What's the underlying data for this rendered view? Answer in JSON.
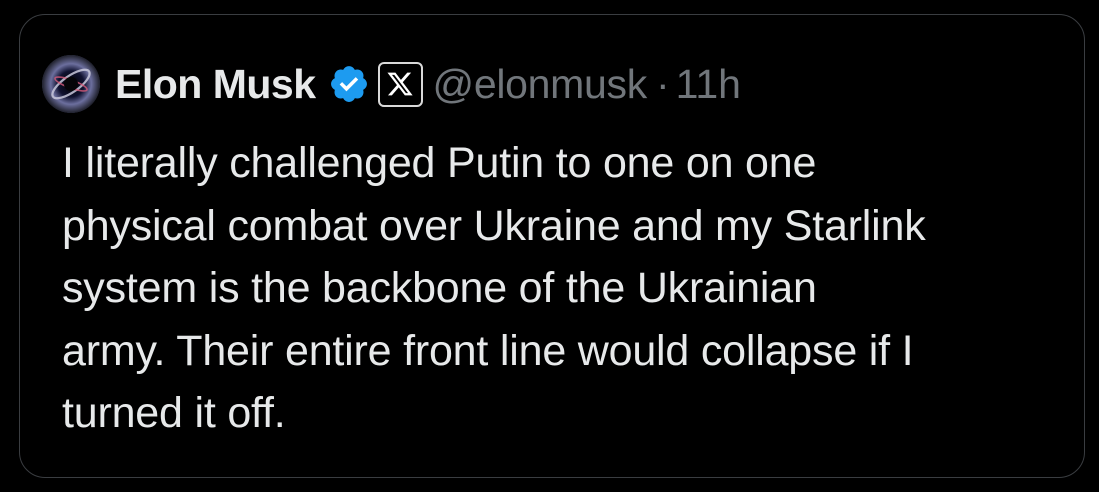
{
  "tweet": {
    "author": {
      "display_name": "Elon Musk",
      "handle": "@elonmusk",
      "verified_icon": "verified-badge-icon",
      "affiliation_icon": "x-logo-icon",
      "avatar_icon": "avatar"
    },
    "separator": "·",
    "timestamp": "11h",
    "text": "I literally challenged Putin to one on one\nphysical combat over Ukraine and my Starlink\nsystem is the backbone of the Ukrainian\narmy. Their entire front line would collapse if I\nturned it off."
  },
  "colors": {
    "background": "#000000",
    "text_primary": "#e7e9ea",
    "text_secondary": "#71767b",
    "verified_blue": "#1d9bf0",
    "border": "#3a3d41"
  }
}
